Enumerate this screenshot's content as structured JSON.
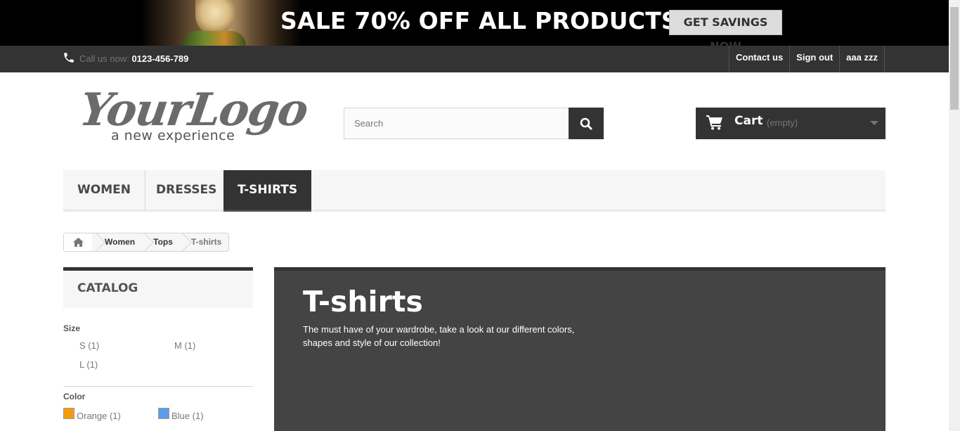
{
  "promo": {
    "headline": "SALE 70% OFF ALL PRODUCTS",
    "cta_label": "GET SAVINGS NOW"
  },
  "topbar": {
    "call_prefix": "Call us now:",
    "phone": "0123-456-789",
    "links": [
      "Contact us",
      "Sign out",
      "aaa zzz"
    ]
  },
  "header": {
    "logo_text": "YourLogo",
    "logo_tagline": "a new experience",
    "search_placeholder": "Search",
    "cart_label": "Cart",
    "cart_status": "(empty)"
  },
  "menu": {
    "items": [
      "WOMEN",
      "DRESSES",
      "T-SHIRTS"
    ],
    "active": "T-SHIRTS"
  },
  "breadcrumb": {
    "items": [
      "Women",
      "Tops"
    ],
    "current": "T-shirts"
  },
  "sidebar": {
    "catalog_title": "CATALOG",
    "size": {
      "title": "Size",
      "options": [
        "S (1)",
        "M (1)",
        "L (1)"
      ]
    },
    "color": {
      "title": "Color",
      "options": [
        {
          "label": "Orange (1)",
          "swatch": "#F39C11"
        },
        {
          "label": "Blue (1)",
          "swatch": "#5D9CEC"
        }
      ]
    }
  },
  "category": {
    "title": "T-shirts",
    "description": "The must have of your wardrobe, take a look at our different colors, shapes and style of our collection!"
  },
  "colors": {
    "dark": "#333333",
    "banner_bg": "#444444",
    "menu_bg": "#F6F6F6"
  }
}
